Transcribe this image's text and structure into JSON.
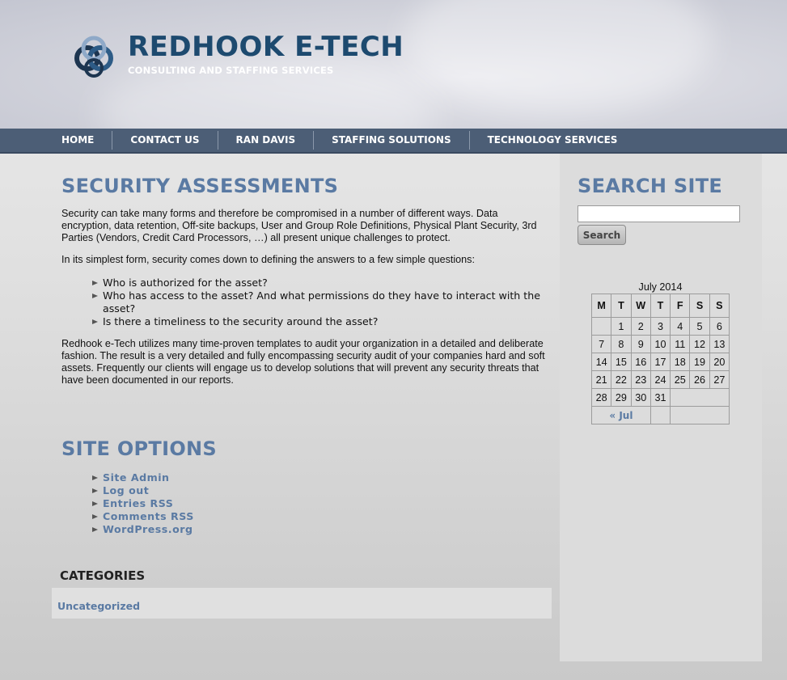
{
  "header": {
    "title": "REDHOOK E-TECH",
    "tagline": "CONSULTING AND STAFFING SERVICES"
  },
  "nav": {
    "items": [
      "HOME",
      "CONTACT US",
      "RAN DAVIS",
      "STAFFING SOLUTIONS",
      "TECHNOLOGY SERVICES"
    ]
  },
  "main": {
    "title": "SECURITY ASSESSMENTS",
    "para1": "Security can take many forms and therefore be compromised in a number of different ways. Data encryption, data retention, Off-site backups, User and Group Role Definitions, Physical Plant Security, 3rd Parties (Vendors, Credit Card Processors, …) all present unique challenges to protect.",
    "para2": "In its simplest form, security comes down to defining the answers to a few simple questions:",
    "bullets": [
      "Who is authorized for the asset?",
      "Who has access to the asset? And what permissions do they have to interact with the asset?",
      "Is there a timeliness to the security around the asset?"
    ],
    "para3": "Redhook e-Tech utilizes many time-proven templates to audit your organization in a detailed and deliberate fashion. The result is a very detailed and fully encompassing security audit of your companies hard and soft assets. Frequently our clients will engage us to develop solutions that will prevent any security threats that have been documented in our reports."
  },
  "site_options": {
    "title": "SITE OPTIONS",
    "links": [
      "Site Admin",
      "Log out",
      "Entries RSS",
      "Comments RSS",
      "WordPress.org"
    ]
  },
  "categories": {
    "title": "CATEGORIES",
    "items": [
      "Uncategorized"
    ]
  },
  "sidebar": {
    "search_title": "SEARCH SITE",
    "search_value": "",
    "search_button": "Search",
    "calendar": {
      "caption": "July 2014",
      "days": [
        "M",
        "T",
        "W",
        "T",
        "F",
        "S",
        "S"
      ],
      "weeks": [
        [
          "",
          "1",
          "2",
          "3",
          "4",
          "5",
          "6"
        ],
        [
          "7",
          "8",
          "9",
          "10",
          "11",
          "12",
          "13"
        ],
        [
          "14",
          "15",
          "16",
          "17",
          "18",
          "19",
          "20"
        ],
        [
          "21",
          "22",
          "23",
          "24",
          "25",
          "26",
          "27"
        ],
        [
          "28",
          "29",
          "30",
          "31"
        ]
      ],
      "prev": "« Jul"
    }
  },
  "colors": {
    "accent": "#5a7aa3",
    "title_dark": "#1d4a6f",
    "nav_bg": "#4c5e76"
  }
}
